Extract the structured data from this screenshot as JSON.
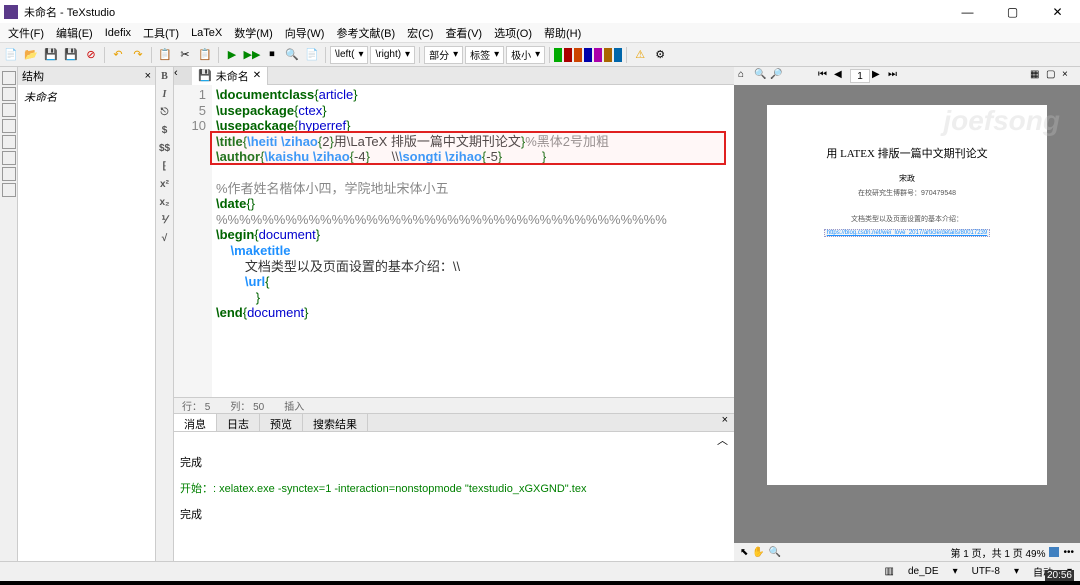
{
  "window": {
    "title": "未命名 - TeXstudio",
    "minimize": "—",
    "maximize": "▢",
    "close": "✕"
  },
  "menu": {
    "file": "文件(F)",
    "edit": "编辑(E)",
    "idefix": "Idefix",
    "tools": "工具(T)",
    "latex": "LaTeX",
    "math": "数学(M)",
    "wizards": "向导(W)",
    "bib": "参考文献(B)",
    "macros": "宏(C)",
    "view": "查看(V)",
    "options": "选项(O)",
    "help": "帮助(H)"
  },
  "toolbar_dropdowns": {
    "left": "\\left(",
    "right": "\\right)",
    "part": "部分",
    "label": "标签",
    "tiny": "极小"
  },
  "struct": {
    "header": "结构",
    "close": "×",
    "item": "未命名"
  },
  "editor_toolbar": {
    "bold": "B",
    "italic": "I"
  },
  "tab": {
    "name": "未命名",
    "close": "✕"
  },
  "line_numbers": [
    "1",
    "",
    "",
    "",
    "5",
    "",
    "",
    "",
    "",
    "10",
    "",
    "",
    "",
    ""
  ],
  "code": {
    "l1_cmd": "\\documentclass",
    "l1_arg": "article",
    "l2_cmd": "\\usepackage",
    "l2_arg": "ctex",
    "l3_cmd": "\\usepackage",
    "l3_arg": "hyperref",
    "l4_cmd": "\\title",
    "l4_font": "\\heiti ",
    "l4_size": "\\zihao",
    "l4_sz_arg": "2",
    "l4_text": "用\\LaTeX 排版一篇中文期刊论文",
    "l4_comment": "%黑体2号加粗",
    "l5_cmd": "\\author",
    "l5_font": "\\kaishu ",
    "l5_size": "\\zihao",
    "l5_sz_arg": "-4",
    "l5_sep": "      \\\\",
    "l5_font2": "\\songti ",
    "l5_size2": "\\zihao",
    "l5_sz_arg2": "-5",
    "l7_comment": "%作者姓名楷体小四，学院地址宋体小五",
    "l8_cmd": "\\date",
    "l9_comment": "%%%%%%%%%%%%%%%%%%%%%%%%%%%%%%%%%%%%%%%",
    "l10_cmd": "\\begin",
    "l10_arg": "document",
    "l11_cmd": "\\maketitle",
    "l12_text": "文档类型以及页面设置的基本介绍：\\\\",
    "l13_cmd": "\\url",
    "l15_cmd": "\\end",
    "l15_arg": "document"
  },
  "status_editor": {
    "line": "行：  5",
    "col": "列：  50",
    "mode": "插入"
  },
  "bottom_panel": {
    "tabs": [
      "消息",
      "日志",
      "预览",
      "搜索结果"
    ],
    "close": "×",
    "expand": "︿",
    "line1": "完成",
    "line2": "开始：: xelatex.exe -synctex=1 -interaction=nonstopmode \"texstudio_xGXGND\".tex",
    "line3": "完成"
  },
  "preview": {
    "page_input": "1",
    "title": "用 LATEX 排版一篇中文期刊论文",
    "author": "宋政",
    "inst": "在校研究生博群号：970479548",
    "desc": "文档类型以及页面设置的基本介绍：",
    "url": "https://blog.csdn.net/wei_love_2017/article/details/80017239",
    "watermark": "joefsong",
    "status": "第 1 页，共 1 页   49%"
  },
  "statusbar": {
    "lang": "de_DE",
    "encoding": "UTF-8",
    "crlf": "自动",
    "clock": "20:56"
  }
}
